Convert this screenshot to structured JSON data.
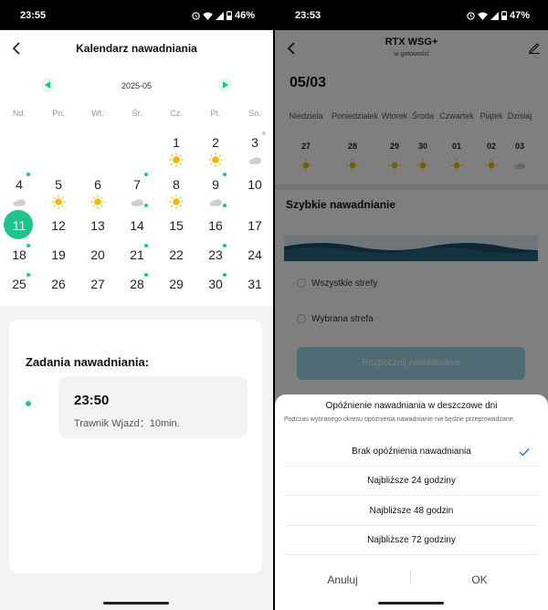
{
  "left": {
    "status": {
      "time": "23:55",
      "battery": "46%"
    },
    "title": "Kalendarz nawadniania",
    "month": "2025-05",
    "weekdays": [
      "Nd.",
      "Pn.",
      "Wt.",
      "Śr.",
      "Cz.",
      "Pt.",
      "So."
    ],
    "days": [
      "1",
      "2",
      "3",
      "4",
      "5",
      "6",
      "7",
      "8",
      "9",
      "10",
      "11",
      "12",
      "13",
      "14",
      "15",
      "16",
      "17",
      "18",
      "19",
      "20",
      "21",
      "22",
      "23",
      "24",
      "25",
      "26",
      "27",
      "28",
      "29",
      "30",
      "31"
    ],
    "selected_day": "11",
    "tasks": {
      "title": "Zadania nawadniania:",
      "items": [
        {
          "time": "23:50",
          "desc": "Trawnik Wjazd：10min."
        }
      ]
    }
  },
  "right": {
    "status": {
      "time": "23:53",
      "battery": "47%"
    },
    "title": "RTX WSG+",
    "subtitle": "w gotowości",
    "date": "05/03",
    "weekdays": [
      "Niedziela",
      "Poniedziałek",
      "Wtorek",
      "Środa",
      "Czwartek",
      "Piątek",
      "Dzisiaj"
    ],
    "dates": [
      "27",
      "28",
      "29",
      "30",
      "01",
      "02",
      "03"
    ],
    "quick_title": "Szybkie nawadnianie",
    "zones": [
      "Wszystkie strefy",
      "Wybrana strefa"
    ],
    "start_button": "Rozpocznij nawadnianie",
    "sheet": {
      "title": "Opóźnienie nawadniania w deszczowe  dni",
      "description": "Podczas wybranego okresu opóźnienia nawadnianie nie będzie przeprowadzane.",
      "options": [
        "Brak opóźnienia nawadniania",
        "Najbliższe 24 godziny",
        "Najbliższe 48 godzin",
        "Najbliższe 72 godziny"
      ],
      "selected_index": 0,
      "cancel": "Anuluj",
      "ok": "OK"
    }
  },
  "colors": {
    "accent": "#1ec48c",
    "sun": "#f5b800",
    "cloud": "#cfcfcf",
    "water": "#1e4f6b"
  }
}
